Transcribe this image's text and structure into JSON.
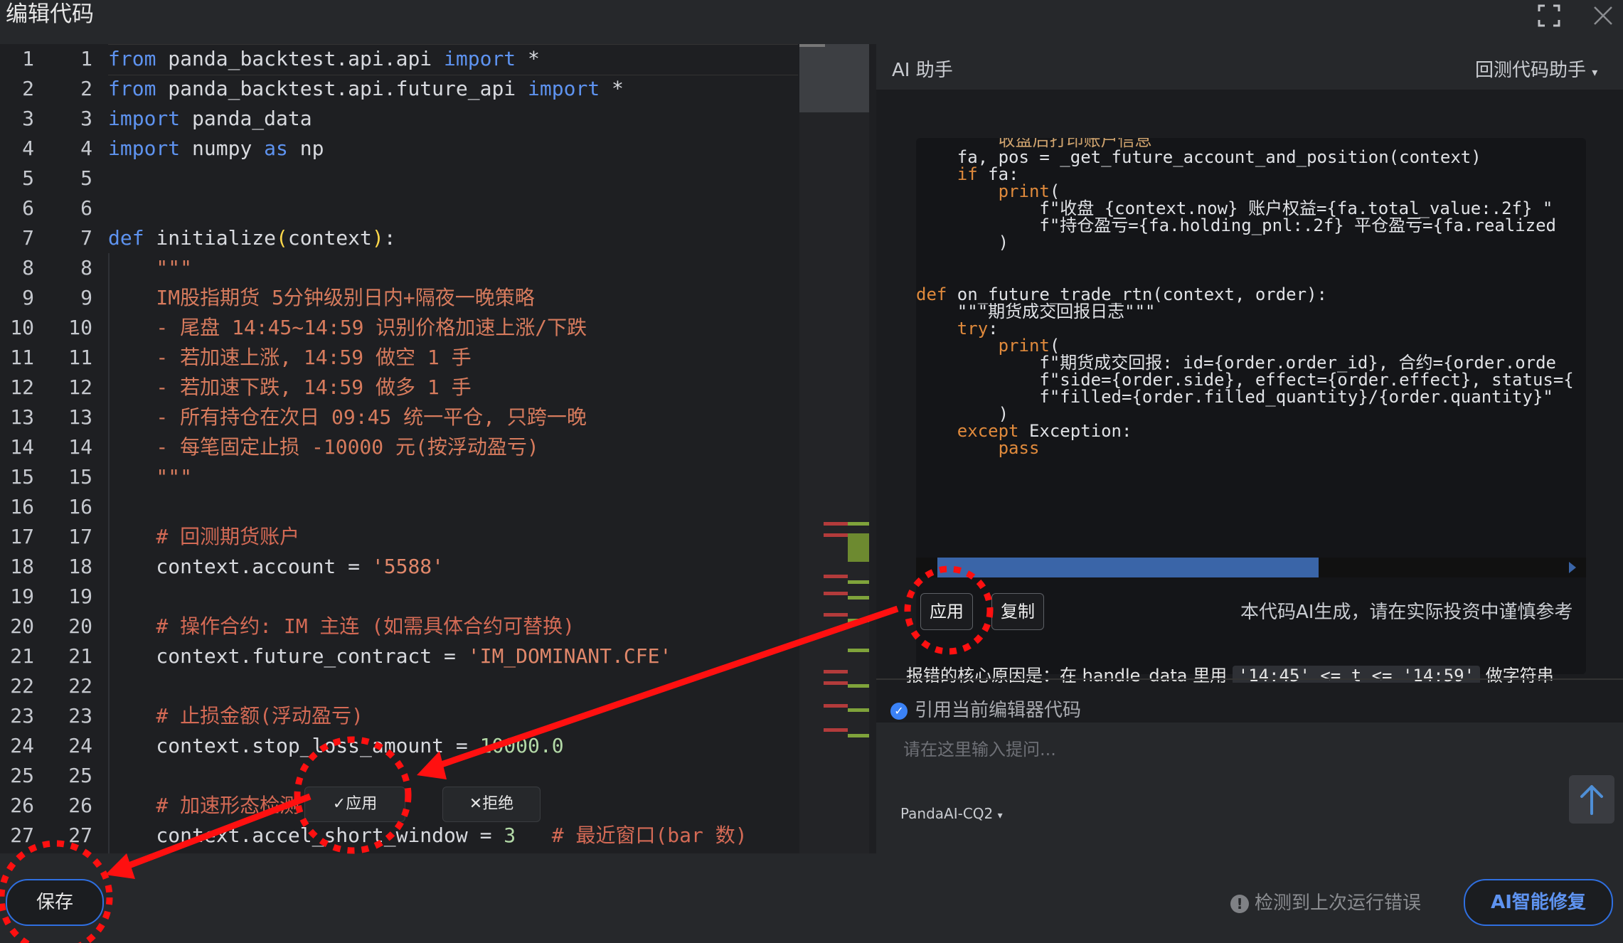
{
  "window": {
    "title": "编辑代码"
  },
  "editor": {
    "line_numbers": [
      "1",
      "2",
      "3",
      "4",
      "5",
      "6",
      "7",
      "8",
      "9",
      "10",
      "11",
      "12",
      "13",
      "14",
      "15",
      "16",
      "17",
      "18",
      "19",
      "20",
      "21",
      "22",
      "23",
      "24",
      "25",
      "26",
      "27"
    ],
    "inline_apply_label": "✓应用",
    "inline_reject_label": "✕拒绝"
  },
  "bottom": {
    "save_label": "保存",
    "error_note": "检测到上次运行错误",
    "ai_fix_label": "AI智能修复"
  },
  "panel": {
    "title": "AI 助手",
    "assistant_select": "回测代码助手",
    "apply_label": "应用",
    "copy_label": "复制",
    "disclaimer": "本代码AI生成，请在实际投资中谨慎参考",
    "cut_text_prefix": "报错的核心原因是：在 handle_data 里用 ",
    "cut_text_code": "'14:45' <= t <= '14:59'",
    "cut_text_suffix": " 做字符串",
    "ref_label": "引用当前编辑器代码",
    "prompt_placeholder": "请在这里输入提问...",
    "model_select": "PandaAI-CQ2"
  },
  "colors": {
    "accent": "#2f6fe0",
    "annotation": "#ff1010"
  }
}
